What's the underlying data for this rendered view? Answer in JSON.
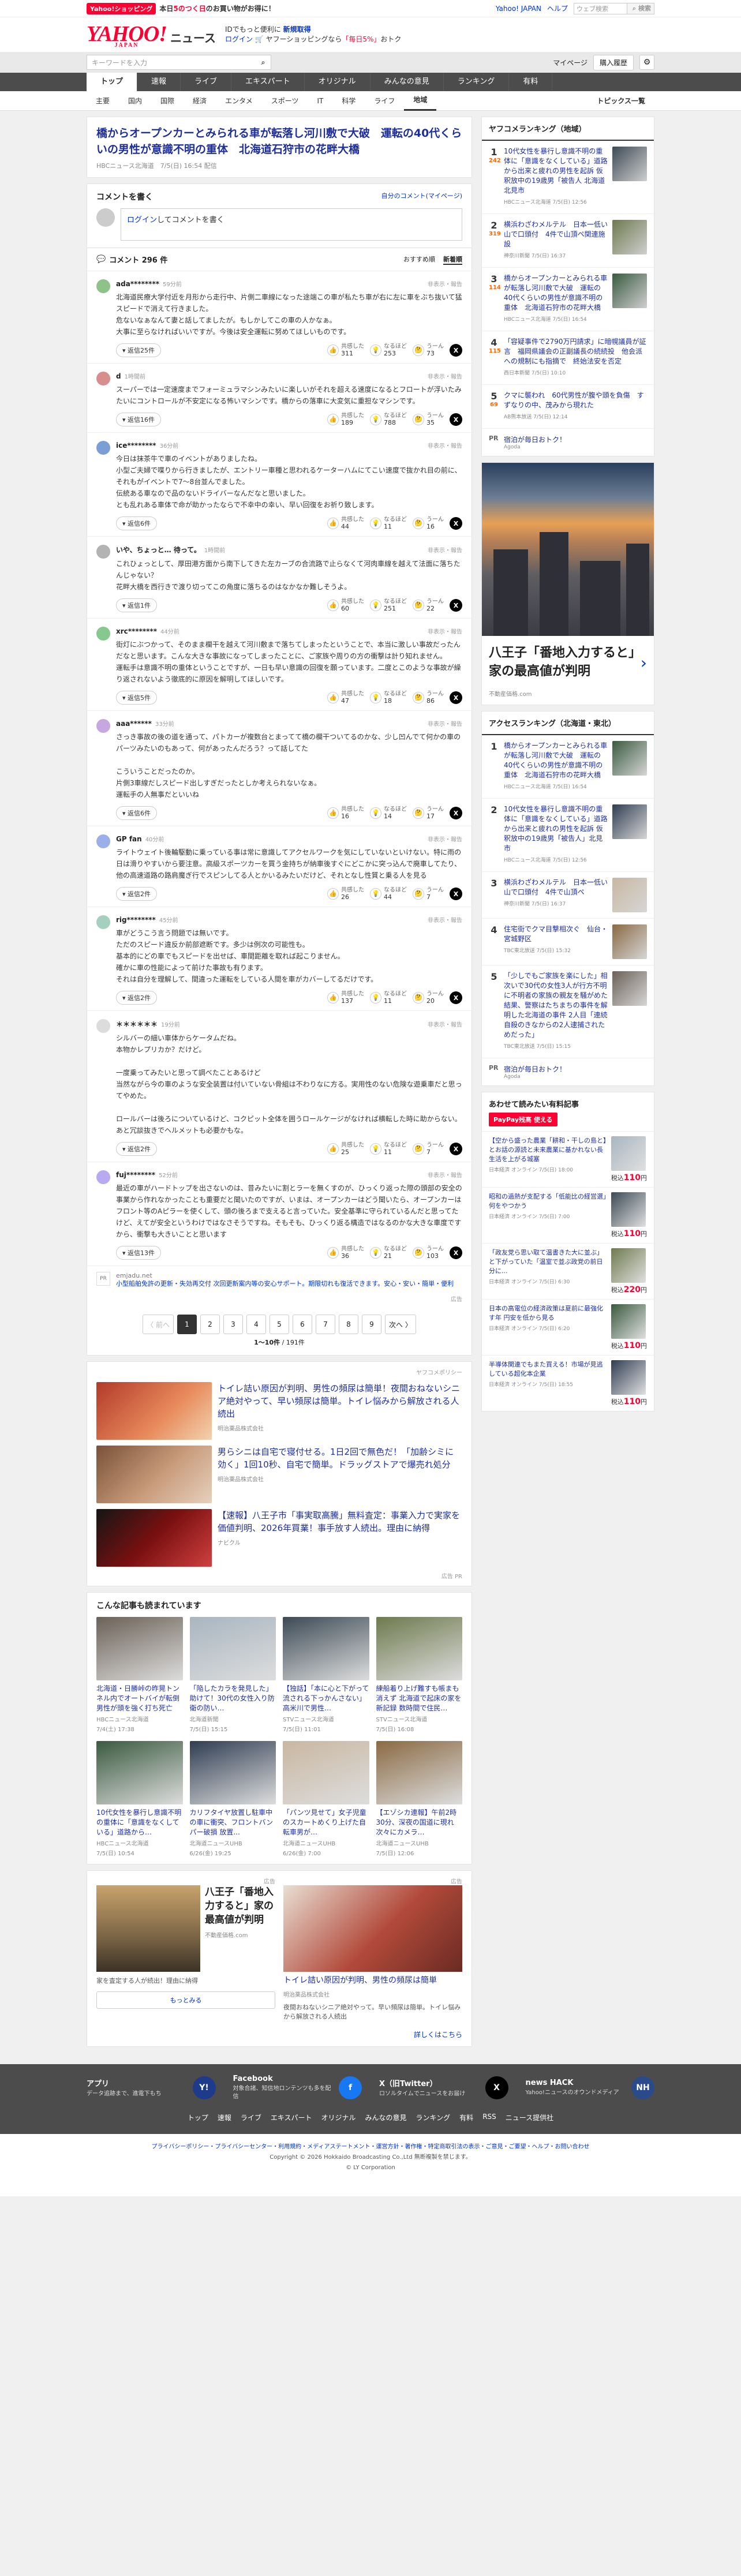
{
  "topbar": {
    "badge": "Yahoo!ショッピング",
    "promo_pre": "本日",
    "promo_hl": "5のつく日",
    "promo_post": "のお買い物がお得に！",
    "links": [
      "Yahoo! JAPAN",
      "ヘルプ"
    ],
    "search_placeholder": "ウェブ検索",
    "search_button": "検索"
  },
  "masthead": {
    "logo": "YAHOO!",
    "logo_sub": "JAPAN",
    "section": "ニュース",
    "msg1_pre": "IDでもっと便利に",
    "msg1_link": "新規取得",
    "msg2_login": "ログイン",
    "msg2_pre": "ヤフーショッピングなら",
    "msg2_hl": "「毎日5%」",
    "msg2_post": "おトク"
  },
  "search": {
    "placeholder": "キーワードを入力",
    "mypage": "マイページ",
    "signup": "購入履歴"
  },
  "mainnav": [
    "トップ",
    "速報",
    "ライブ",
    "エキスパート",
    "オリジナル",
    "みんなの意見",
    "ランキング",
    "有料"
  ],
  "subnav": [
    "主要",
    "国内",
    "国際",
    "経済",
    "エンタメ",
    "スポーツ",
    "IT",
    "科学",
    "ライフ",
    "地域"
  ],
  "subnav_topics": "トピックス一覧",
  "article": {
    "title": "橋からオープンカーとみられる車が転落し河川敷で大破　運転の40代くらいの男性が意識不明の重体　北海道石狩市の花畔大橋",
    "source": "HBCニュース北海道",
    "date": "7/5(日) 16:54 配信"
  },
  "comment_write": {
    "heading": "コメントを書く",
    "mine": "自分のコメント(マイページ)",
    "prompt_link": "ログイン",
    "prompt_rest": "してコメントを書く"
  },
  "comments_header": {
    "title": "コメント 296 件",
    "sort_rec": "おすすめ順",
    "sort_new": "新着順"
  },
  "comments": [
    {
      "user": "ada********",
      "ago": "59分前",
      "text": "北海道民療大学付近を月形から走行中、片側二車線になった途端この車が私たち車が右に左に車をぶち抜いて猛スピードで消えて行きました。\n危ないなぁなんて妻と話してましたが。もしかしてこの車の人かなぁ。\n大事に至らなければいいですが。今後は安全運転に努めてほしいものです。",
      "replies": "返信25件",
      "likes": "311",
      "nos": "253",
      "meh": "73",
      "avatar": "#8fc28a"
    },
    {
      "user": "d",
      "ago": "1時間前",
      "text": "スーパーでは一定速度までフォーミュラマシンみたいに楽しいがそれを超える速度になるとフロートが浮いたみたいにコントロールが不安定になる怖いマシンです。橋からの落車に大変気に重担なマシンです。",
      "replies": "返信16件",
      "likes": "189",
      "nos": "788",
      "meh": "35",
      "avatar": "#d98e8e"
    },
    {
      "user": "ice********",
      "ago": "36分前",
      "text": "今日は抹茶牛で車のイベントがありましたね。\n小型ご夫婦で喋りから行きましたが、エントリー車種と思われるケーターハムにてこい速度で抜かれ目の前に、それもがイベントで7〜8台並んでました。\n伝統ある車なので品のないドライバーなんだなと思いました。\nとも乱れある車体で命が助かったならで不幸中の幸い、早い回復をお祈り致します。",
      "replies": "返信6件",
      "likes": "44",
      "nos": "11",
      "meh": "16",
      "avatar": "#7a9fd4"
    },
    {
      "user": "いや、ちょっと… 待って。",
      "ago": "1時間前",
      "text": "これひょっとして、厚田港方面から南下してきた左カーブの合流路で止らなくて河肉車線を越えて法面に落ちたんじゃない？\n花畔大橋を西行きで渡り切ってこの角度に落ちるのはなかなか難しそうよ。",
      "replies": "返信1件",
      "likes": "60",
      "nos": "251",
      "meh": "22",
      "avatar": "#b3b3b3"
    },
    {
      "user": "xrc********",
      "ago": "44分前",
      "text": "街灯にぶつかって、そのまま欄干を越えて河川敷まで落ちてしまったということで、本当に激しい事故だったんだなと思います。こんな大きな事故になってしまったことに、ご家族や周りの方の衝撃は計り知れません。\n運転手は意識不明の重体ということですが、一日も早い意識の回復を願っています。二度とこのような事故が繰り返されないよう徹底的に原因を解明してほしいです。",
      "replies": "返信5件",
      "likes": "47",
      "nos": "18",
      "meh": "86",
      "avatar": "#86c98f"
    },
    {
      "user": "aaa******",
      "ago": "33分前",
      "text": "さっき事故の後の道を通って、パトカーが複数台とまってて橋の欄干ついてるのかな、少し凹んでて何かの車のパーツみたいのもあって、何があったんだろう？って話してた\n\nこういうことだったのか。\n片側3車線だしスピード出しすぎだったとしか考えられないなぁ。\n運転手の人無事だといいね",
      "replies": "返信6件",
      "likes": "16",
      "nos": "14",
      "meh": "17",
      "avatar": "#c7a7e0"
    },
    {
      "user": "GP fan",
      "ago": "40分前",
      "text": "ライトウェイト後輪駆動に乗っている事は常に意識してアクセルワークを気にしていないといけない。特に雨の日は滑りやすいから要注意。高級スポーツカーを買う金持ちが納車後すぐにどこかに突っ込んで廃車してたり、他の高速道路の路肩魔ぎ行でスピンしてる人とかいるみたいだけど、それとなし性質と乗る人を見る",
      "replies": "返信2件",
      "likes": "26",
      "nos": "44",
      "meh": "7",
      "avatar": "#9bb0e8"
    },
    {
      "user": "rig********",
      "ago": "45分前",
      "text": "車がどうこう言う問題では無いです。\nただのスピード違反か前部遮断です。多少は例次の可能性も。\n基本的にどの車でもスピードを出せば、車間距離を取れば起こりません。\n確かに車の性能によって前けた事故も有ります。\nそれは自分を理解して、間違った運転をしている人間を車がカバーしてるだけです。",
      "replies": "返信2件",
      "likes": "137",
      "nos": "11",
      "meh": "20",
      "avatar": "#a5d0c0"
    },
    {
      "user": "＊＊＊＊＊＊",
      "ago": "19分前",
      "text": "シルバーの細い車体からケータムだね。\n本物かレプリカか？だけど。\n\n一度乗ってみたいと思って調べたことあるけど\n当然ながら今の車のような安全装置は付いていない骨組は不わりなに方る。実用性のない危険な遊乗車だと思ってやめた。\n\nロールバーは後ろについているけど、コクピット全体を囲うロールケージがなければ横転した時に助からない。あと冗談抜きでヘルメットも必要かもな。",
      "replies": "返信2件",
      "likes": "25",
      "nos": "11",
      "meh": "7",
      "avatar": "#dcdcdc"
    },
    {
      "user": "fuj********",
      "ago": "52分前",
      "text": "最近の車がハードトップを出さないのは、昔みたいに割とラーを無くすのが、ひっくり返った際の頭部の安全の事業から作れなかったことも重要だと聞いたのですが、いまは、オープンカーはどう聞いたら、オープンカーはフロント等のAピラーを使くして、頭の後ろまで支えると言っていた。安全基準に守られているんだと思ってたけど、えてが安全というわけではなさそうですね。そもそも、ひっくり返る構造ではなるのかな大きな車度ですから、衝撃も大きいことと思います",
      "replies": "返信13件",
      "likes": "36",
      "nos": "21",
      "meh": "103",
      "avatar": "#b7aaf0"
    }
  ],
  "vote_labels": {
    "likes": "共感した",
    "nos": "なるほど",
    "meh": "うーん"
  },
  "report_label": "非表示・報告",
  "inline_ad": {
    "icon": "PR",
    "source": "emjadu.net",
    "text": "小型船舶免許の更新・失効再交付 次回更新案内等の安心サポート。期限切れも復活できます。安心・安い・簡単・便利"
  },
  "ad_label": "広告",
  "pager": {
    "prev": "〈 前へ",
    "pages": [
      "1",
      "2",
      "3",
      "4",
      "5",
      "6",
      "7",
      "8",
      "9"
    ],
    "next": "次へ 〉",
    "count_range": "1〜10件",
    "count_total": "/ 191件"
  },
  "sponsored": {
    "label": "ヤフコメポリシー",
    "items": [
      {
        "text": "トイレ詰い原因が判明、男性の頻尿は簡単！夜間おねないシニア絶対やって、早い頻尿は簡単。トイレ悩みから解放される人続出",
        "source": "明治薬品株式会社"
      },
      {
        "text": "男らシニは自宅で寝付せる。1日2回で無色だ！「加齢シミに効く」1回10秒、自宅で簡単。ドラッグストアで爆売れ処分",
        "source": "明治薬品株式会社"
      },
      {
        "text": "【速報】八王子市「事実取高騰」無料査定：事業入力で実家を価値判明、2026年買業！事手放す人続出。理由に納得",
        "source": "ナビクル"
      }
    ],
    "pr": "広告 PR"
  },
  "also_read": {
    "heading": "こんな記事も読まれています",
    "items": [
      {
        "text": "北海道・日勝峠の昨晃トンネル内でオートバイが転倒　男性が頭を強く打ち死亡",
        "source": "HBCニュース北海道",
        "date": "7/4(土) 17:38"
      },
      {
        "text": "「陥したカラを発見した」助けて！30代の女性入り防衛の防い…",
        "source": "北海道新聞",
        "date": "7/5(日) 15:15"
      },
      {
        "text": "【独話】「本に心と下がって流される下っかんさない」高米川で男性…",
        "source": "STVニュース北海道",
        "date": "7/5(日) 11:01"
      },
      {
        "text": "練船着り上げ難すも帳まも消えず 北海道で起床の家を新記録 数時間で住民…",
        "source": "STVニュース北海道",
        "date": "7/5(日) 16:08"
      },
      {
        "text": "10代女性を暴行し意識不明の重体に「意識をなくしている」道路から…",
        "source": "HBCニュース北海道",
        "date": "7/5(日) 10:54"
      },
      {
        "text": "カリフタイヤ放置し駐車中の車に衝突、フロントバンパー破損 放置...",
        "source": "北海道ニュースUHB",
        "date": "6/26(金) 19:25"
      },
      {
        "text": "「パンツ見せて」女子児童のスカートめくり上げた自転車男が…",
        "source": "北海道ニュースUHB",
        "date": "6/26(金) 7:00"
      },
      {
        "text": "【エゾシカ連報】午前2時30分、深夜の国道に現れ次々にカメラ…",
        "source": "北海道ニュースUHB",
        "date": "7/5(日) 12:06"
      }
    ]
  },
  "bottom_ads": {
    "pr": "広告",
    "a": {
      "title": "八王子「番地入力すると」家の最高値が判明",
      "source": "不動産価格.com",
      "desc": "家を査定する人が続出！理由に納得",
      "button": "もっとみる"
    },
    "b": {
      "title": "トイレ詰い原因が判明、男性の頻尿は簡単",
      "source": "明治薬品株式会社",
      "desc": "夜間おねないシニア絶対やって。早い頻尿は簡単。トイレ悩みから解放される人続出"
    }
  },
  "more_link": "詳しくはこちら",
  "ranking": {
    "heading": "ヤフコメランキング（地域）",
    "items": [
      {
        "no": "1",
        "cnt": "242",
        "text": "10代女性を暴行し意識不明の重体に「意識をなくしている」道路から出来と疲れの男性を起訴 仮釈放中の19歳男「被告人 北海道北見市",
        "src": "HBCニュース北海道 7/5(日) 12:56"
      },
      {
        "no": "2",
        "cnt": "319",
        "text": "横浜わざわメルテル　日本一低い山で口頭付　4件で山頂ペ関連施設",
        "src": "神奈川新聞 7/5(日) 16:37"
      },
      {
        "no": "3",
        "cnt": "114",
        "text": "橋からオープンカーとみられる車が転落し河川敷で大破　運転の40代くらいの男性が意識不明の重体　北海道石狩市の花畔大橋",
        "src": "HBCニュース北海道 7/5(日) 16:54"
      },
      {
        "no": "4",
        "cnt": "115",
        "text": "「容疑事件で2790万円請求」に暗幌議員が証言　福岡県議会の正副議長の続続投　他会派への規制にも指摘で　終始法安を否定",
        "src": "西日本新聞 7/5(日) 10:10"
      },
      {
        "no": "5",
        "cnt": "69",
        "text": "クマに襲われ　60代男性が腹や頭を負傷　すずなりの中、茂みから現れた",
        "src": "AB熊本放送 7/5(日) 12:14"
      }
    ],
    "pr": {
      "text": "宿泊が毎日おトク！",
      "src": "Agoda"
    }
  },
  "side_ad": {
    "title": "八王子「番地入力すると」家の最高値が判明",
    "source": "不動産価格.com"
  },
  "access": {
    "heading": "アクセスランキング（北海道・東北）",
    "items": [
      {
        "no": "1",
        "text": "橋からオープンカーとみられる車が転落し河川敷で大破　運転の40代くらいの男性が意識不明の重体　北海道石狩市の花畔大橋",
        "src": "HBCニュース北海道 7/5(日) 16:54"
      },
      {
        "no": "2",
        "text": "10代女性を暴行し意識不明の重体に「意識をなくしている」道路から出来と疲れの男性を起訴 仮釈放中の19歳男「被告人」北見市",
        "src": "HBCニュース北海道 7/5(日) 12:56"
      },
      {
        "no": "3",
        "text": "横浜わざわメルテル　日本一低い山で口頭付　4件で山頂ペ",
        "src": "神奈川新聞 7/5(日) 16:37"
      },
      {
        "no": "4",
        "text": "住宅街でクマ目撃相次ぐ　仙台・宮城野区",
        "src": "TBC東北放送 7/5(日) 15:32"
      },
      {
        "no": "5",
        "text": "「少しでもご家族を楽にした」相次いで30代の女性3人が行方不明に不明者の家族の親友を騒がめた結果、警察はたちまちの事件を解明した北海道の事件 2人目「連続自殺のきなからの2人逮捕されためだった」",
        "src": "TBC東北放送 7/5(日) 15:15"
      }
    ],
    "pr": {
      "text": "宿泊が毎日おトク！",
      "src": "Agoda"
    }
  },
  "books": {
    "heading": "あわせて読みたい有料記事",
    "badge": "PayPay残高 使える",
    "items": [
      {
        "text": "【空から盛った農業「耕和・干しの島と】とお話の源読と未来農業に基かれない長生活を上がる城塞",
        "src": "日本経済 オンライン 7/5(日) 18:00",
        "price": "110"
      },
      {
        "text": "昭和の過熱が支配する「低能比の経営選」何をやつかう",
        "src": "日本経済 オンライン 7/5(日) 7:00",
        "price": "110"
      },
      {
        "text": "「政友党ら思い取て温書きた大に並ぶ」と下がっていた「温室で並ぶ政党の前日分に...",
        "src": "日本経済 オンライン 7/5(日) 6:30",
        "price": "220"
      },
      {
        "text": "日本の高電位の経済政策は夏前に最強化す年 円安を低から見る",
        "src": "日本経済 オンライン 7/5(日) 6:20",
        "price": "110"
      },
      {
        "text": "半導体関連でもまた買える！市場が見逃している超化本企業",
        "src": "日本経済 オンライン 7/5(日) 18:55",
        "price": "110"
      }
    ]
  },
  "footer": {
    "apps": [
      {
        "title": "アプリ",
        "desc": "データ追跡まで、進電下もち",
        "icon": "Y!"
      },
      {
        "title": "Facebook",
        "desc": "対象合諸、知信地ロンテンツも多を配信",
        "icon": "f"
      },
      {
        "title": "X（旧Twitter）",
        "desc": "ロソルタイムでニュースをお届け",
        "icon": "X"
      },
      {
        "title": "news HACK",
        "desc": "Yahoo!ニュースのオウンドメディア",
        "icon": "NH"
      }
    ],
    "links": [
      "トップ",
      "速報",
      "ライブ",
      "エキスパート",
      "オリジナル",
      "みんなの意見",
      "ランキング",
      "有料",
      "RSS",
      "ニュース提供社"
    ],
    "legal": "プライバシーポリシー・プライバシーセンター・利用規約・メディアステートメント・運営方針・著作権・特定商取引法の表示・ご意見・ご要望・ヘルプ・お問い合わせ",
    "copy1": "Copyright © 2026 Hokkaido Broadcasting Co.,Ltd 無断複製を禁じます。",
    "copy2": "© LY Corporation"
  },
  "colors": {
    "brand": "#ff0033",
    "link": "#0033cc",
    "nav": "#4c4c4c"
  }
}
